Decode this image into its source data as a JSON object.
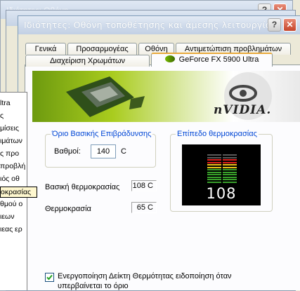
{
  "back_window": {
    "title": "Ιδιότητες: Οθόνη"
  },
  "main_window": {
    "title": "Ιδιότητες: Οθόνη τοποθέτησης και άμεσης λειτουργία..."
  },
  "tabs_row1": [
    "Γενικά",
    "Προσαρμογέας",
    "Οθόνη",
    "Αντιμετώπιση προβλημάτων"
  ],
  "tabs_row2": [
    "Διαχείριση Χρωμάτων",
    "GeForce FX 5900 Ultra"
  ],
  "banner": {
    "logo_text": "nVIDIA."
  },
  "left_list": [
    "ltra",
    "ς",
    "μίσεις",
    "ιμάτων",
    "ς προ",
    "προβλή",
    "ιός οθ",
    "οκρασίας",
    "θμού ο",
    "ιεων",
    "ιεας ερ"
  ],
  "slowdown_group": {
    "title": "Όριο Βασικής Επιβράδυνσης",
    "degrees_label": "Βαθμοί:",
    "degrees_value": "140",
    "unit": "C"
  },
  "core_temp": {
    "label": "Βασική θερμοκρασίας",
    "value": "108 C"
  },
  "ambient_temp": {
    "label": "Θερμοκρασία",
    "value": "65 C"
  },
  "temp_level_group": {
    "title": "Επίπεδο θερμοκρασίας",
    "reading": "108"
  },
  "checkbox": {
    "label_line1": "Ενεργοποίηση Δείκτη Θερμότητας  ειδοποίηση όταν",
    "label_line2": "υπερβαίνεται το όριο",
    "checked": true
  },
  "colors": {
    "accent_blue": "#0046d5",
    "bar_red": "#e0201a",
    "bar_yellow": "#e8c019",
    "bar_green": "#38a02a",
    "bar_gray": "#5a5a5a"
  },
  "temp_bars_filled": 10,
  "temp_bars_total": 12
}
